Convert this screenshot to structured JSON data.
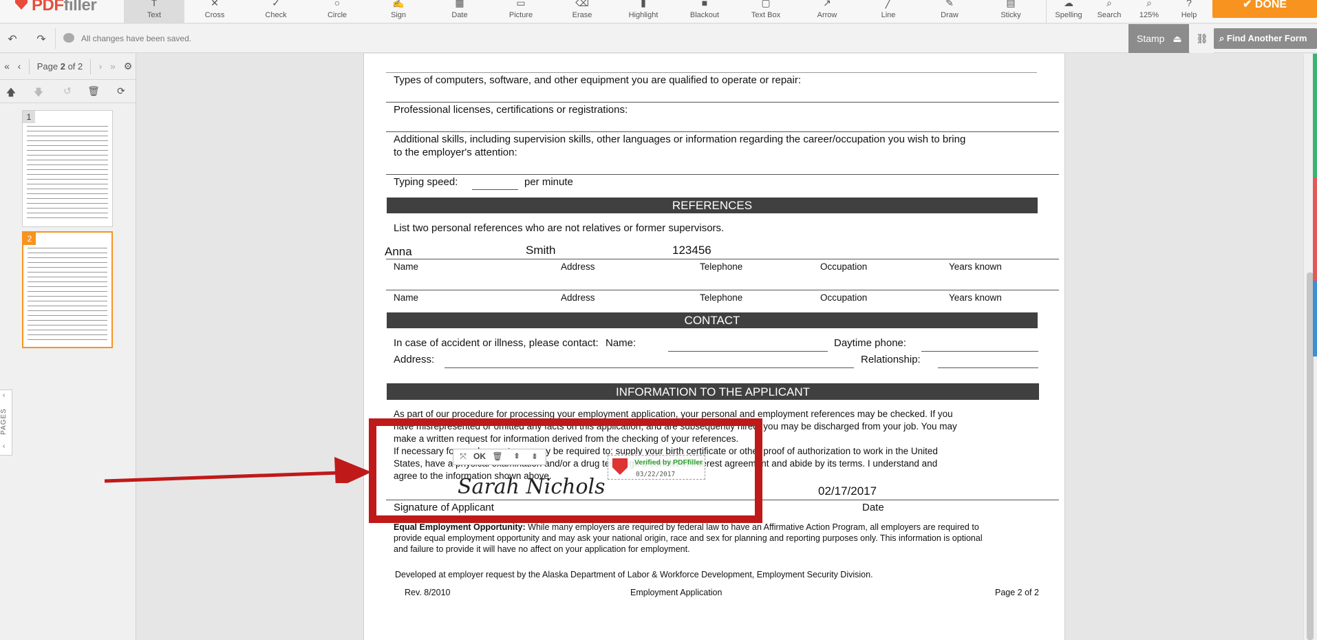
{
  "app": {
    "logo": "PDFfiller",
    "colors": {
      "accent": "#f7931e",
      "brand_red": "#e74c3c",
      "annotation_red": "#c01919",
      "verified_green": "#2a9d2a"
    }
  },
  "toolbar": {
    "tools": [
      {
        "label": "Text",
        "icon": "text-icon"
      },
      {
        "label": "Cross",
        "icon": "cross-icon"
      },
      {
        "label": "Check",
        "icon": "check-icon"
      },
      {
        "label": "Circle",
        "icon": "circle-icon"
      },
      {
        "label": "Sign",
        "icon": "sign-icon"
      },
      {
        "label": "Date",
        "icon": "date-icon"
      },
      {
        "label": "Picture",
        "icon": "picture-icon"
      },
      {
        "label": "Erase",
        "icon": "erase-icon"
      },
      {
        "label": "Highlight",
        "icon": "highlight-icon"
      },
      {
        "label": "Blackout",
        "icon": "blackout-icon"
      },
      {
        "label": "Text Box",
        "icon": "text-box-icon"
      },
      {
        "label": "Arrow",
        "icon": "arrow-icon"
      },
      {
        "label": "Line",
        "icon": "line-icon"
      },
      {
        "label": "Draw",
        "icon": "draw-icon"
      },
      {
        "label": "Sticky",
        "icon": "sticky-icon"
      }
    ],
    "right_tools": [
      {
        "label": "Spelling",
        "icon": "spelling-icon"
      },
      {
        "label": "Search",
        "icon": "search-icon"
      },
      {
        "label": "125%",
        "icon": "zoom-icon"
      },
      {
        "label": "Help",
        "icon": "help-icon"
      }
    ],
    "done_label": "DONE"
  },
  "subbar": {
    "saved_text": "All changes have been saved.",
    "stamp_label": "Stamp",
    "find_label": "Find Another Form"
  },
  "pages_panel": {
    "page_prefix": "Page",
    "current_page": "2",
    "page_suffix": "of 2",
    "thumbs": [
      "1",
      "2"
    ],
    "tab_label": "PAGES"
  },
  "document": {
    "q_computers": "Types of computers, software, and other equipment you are qualified to operate or repair:",
    "q_licenses": "Professional licenses, certifications or registrations:",
    "q_skills_1": "Additional skills, including supervision skills, other languages or information regarding the career/occupation you wish to bring",
    "q_skills_2": "to the employer's attention:",
    "typing_label": "Typing speed:",
    "typing_unit": "per  minute",
    "references_header": "REFERENCES",
    "references_intro": "List two personal references who are not relatives or former supervisors.",
    "ref_columns": [
      "Name",
      "Address",
      "Telephone",
      "Occupation",
      "Years known"
    ],
    "ref1_values": {
      "name": "Anna",
      "address": "Smith",
      "telephone": "123456"
    },
    "contact_header": "CONTACT",
    "contact_line": "In case of accident or illness, please contact:",
    "contact_name_label": "Name:",
    "contact_daytime_label": "Daytime phone:",
    "contact_address_label": "Address:",
    "contact_relationship_label": "Relationship:",
    "info_header": "INFORMATION TO THE APPLICANT",
    "info_lines": [
      "As part of our procedure for processing your employment application, your personal and employment references may be checked. If you",
      "have misrepresented or omitted any facts on this application, and are subsequently hired, you may be discharged from your job. You may",
      "make a written request for information derived from the checking of your references.",
      "If necessary for employment, you may be required to: supply your birth certificate or other proof of authorization to work in the United",
      "States, have a physical examination and/or a drug test, sign a conflict of interest agreement and abide by its terms. I understand and",
      "agree to the information shown above."
    ],
    "signature_value": "Sarah Nichols",
    "date_value": "02/17/2017",
    "signature_label": "Signature of Applicant",
    "date_label": "Date",
    "eeo_bold": "Equal Employment Opportunity:",
    "eeo_lines": [
      " While many employers are required by federal law to have an Affirmative Action Program, all employers are required to",
      "provide equal employment opportunity and may ask your national origin, race and sex for planning and reporting purposes only. This information is optional",
      "and failure to provide it will have no affect on your application for employment."
    ],
    "developed_by": "Developed at employer request by the Alaska Department of Labor & Workforce Development, Employment Security Division.",
    "rev": "Rev. 8/2010",
    "footer_center": "Employment Application",
    "footer_page": "Page 2 of 2"
  },
  "stamp_overlay": {
    "verified_text": "Verified by PDFfiller",
    "verified_date": "03/22/2017",
    "mini_toolbar": [
      "move-icon",
      "OK",
      "trash-icon",
      "bring-forward-icon",
      "send-backward-icon"
    ]
  }
}
